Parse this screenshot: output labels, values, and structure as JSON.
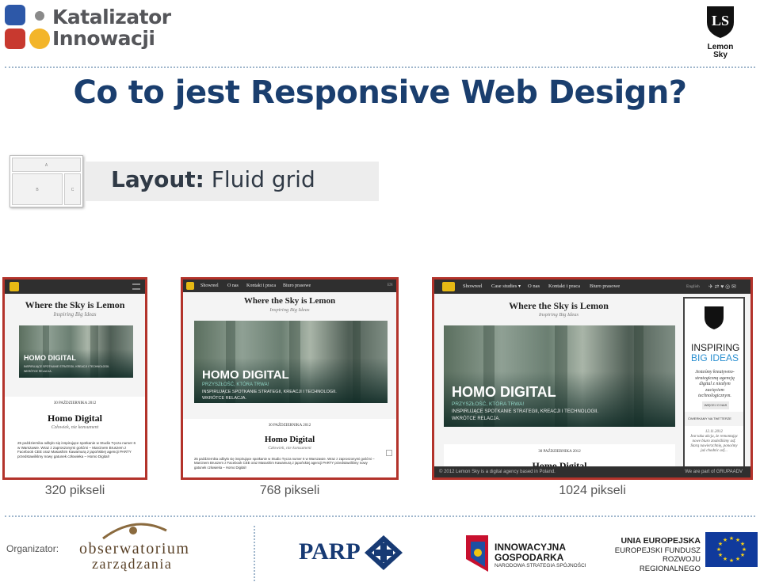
{
  "header": {
    "logo_left_line1": "Katalizator",
    "logo_left_line2": "Innowacji",
    "logo_right_name_line1": "Lemon",
    "logo_right_name_line2": "Sky",
    "logo_right_monogram": "LS"
  },
  "slide": {
    "title": "Co to jest Responsive Web Design?",
    "layout_label": "Layout:",
    "layout_value": "Fluid grid",
    "layout_icon": {
      "a": "A",
      "b": "B",
      "c": "C"
    }
  },
  "screenshots": [
    {
      "caption": "320 pikseli",
      "tagline": "Where the Sky is Lemon",
      "subtagline": "Inspiring Big Ideas",
      "hero_title": "HOMO DIGITAL",
      "hero_line": "INSPIRUJĄCE SPOTKANIE STRATEGII, KREACJI I TECHNOLOGII.",
      "hero_line2": "WKRÓTCE RELACJA.",
      "date": "30 PAŹDZIERNIKA 2012",
      "post_title": "Homo Digital",
      "post_sub": "Człowiek, nie konsument",
      "post_body": "25 października odbyło się inspirujące spotkanie w Studio Tęcza numer 6 w Warszawie. Wraz z zaproszonymi gośćmi – Marcinem Bruszem z Facebook CEE oraz Masashim Kawamurą z japońskiej agencji PARTY przedstawiliśmy nowy gatunek człowieka – Homo Digital!"
    },
    {
      "caption": "768 pikseli",
      "nav": [
        "Showreel",
        "O nas",
        "Kontakt i praca",
        "Biuro prasowe"
      ],
      "lang": "EN",
      "tagline": "Where the Sky is Lemon",
      "subtagline": "Inspiring Big Ideas",
      "hero_title": "HOMO DIGITAL",
      "hero_sub": "PRZYSZŁOŚĆ, KTÓRA TRWA!",
      "hero_line": "INSPIRUJĄCE SPOTKANIE STRATEGII, KREACJI I TECHNOLOGII.",
      "hero_line2": "WKRÓTCE RELACJA.",
      "date": "30 PAŹDZIERNIKA 2012",
      "post_title": "Homo Digital",
      "post_sub": "Człowiek, nie konsument",
      "post_body": "25 października odbyło się inspirujące spotkanie w Studio Tęcza numer 6 w Warszawie. Wraz z zaproszonymi gośćmi – Marcinem Bruszem z Facebook CEE oraz Masashim Kawamurą z japońskiej agencji PARTY przedstawiliśmy nowy gatunek człowieka – Homo Digital!"
    },
    {
      "caption": "1024 pikseli",
      "nav": [
        "Showreel",
        "Case studies",
        "O nas",
        "Kontakt i praca",
        "Biuro prasowe"
      ],
      "lang": "English",
      "tagline": "Where the Sky is Lemon",
      "subtagline": "Inspiring Big Ideas",
      "hero_title": "HOMO DIGITAL",
      "hero_sub": "PRZYSZŁOŚĆ, KTÓRA TRWA!",
      "hero_line": "INSPIRUJĄCE SPOTKANIE STRATEGII, KREACJI I TECHNOLOGII.",
      "hero_line2": "WKRÓTCE RELACJA.",
      "date": "30 PAŹDZIERNIKA 2012",
      "post_title": "Homo Digital",
      "side_big1": "INSPIRING",
      "side_big2": "BIG IDEAS",
      "side_text": "Jesteśmy kreatywno-strategiczną agencją digital z niezłym zacięciem technologicznym.",
      "side_more": "WIĘCEJ O NAS",
      "side_twitter": "ĆWIERKAMY  NA TWITTERZE",
      "side_tweet_date": "12.11.2012",
      "side_tweet": "Jest taka akcja, że remontując nowe biuro znaleźliśmy asf. Starą nawierzchnię, ponoćmy już chodnic asf...",
      "footer": "© 2012  Lemon Sky  is a digital agency based in Poland.",
      "footer_right": "We are part of GRUPAADV"
    }
  ],
  "footer": {
    "organizer_label": "Organizator:",
    "obs_line1": "obserwatorium",
    "obs_line2": "zarządzania",
    "parp": "PARP",
    "innow_line1": "INNOWACYJNA",
    "innow_line2": "GOSPODARKA",
    "innow_sub": "NARODOWA STRATEGIA SPÓJNOŚCI",
    "ue_line1": "UNIA EUROPEJSKA",
    "ue_line2": "EUROPEJSKI FUNDUSZ",
    "ue_line3": "ROZWOJU REGIONALNEGO"
  },
  "colors": {
    "title": "#1a3e6e",
    "frame": "#b3332b",
    "nav": "#2f2f2f",
    "accent": "#e6b914"
  }
}
